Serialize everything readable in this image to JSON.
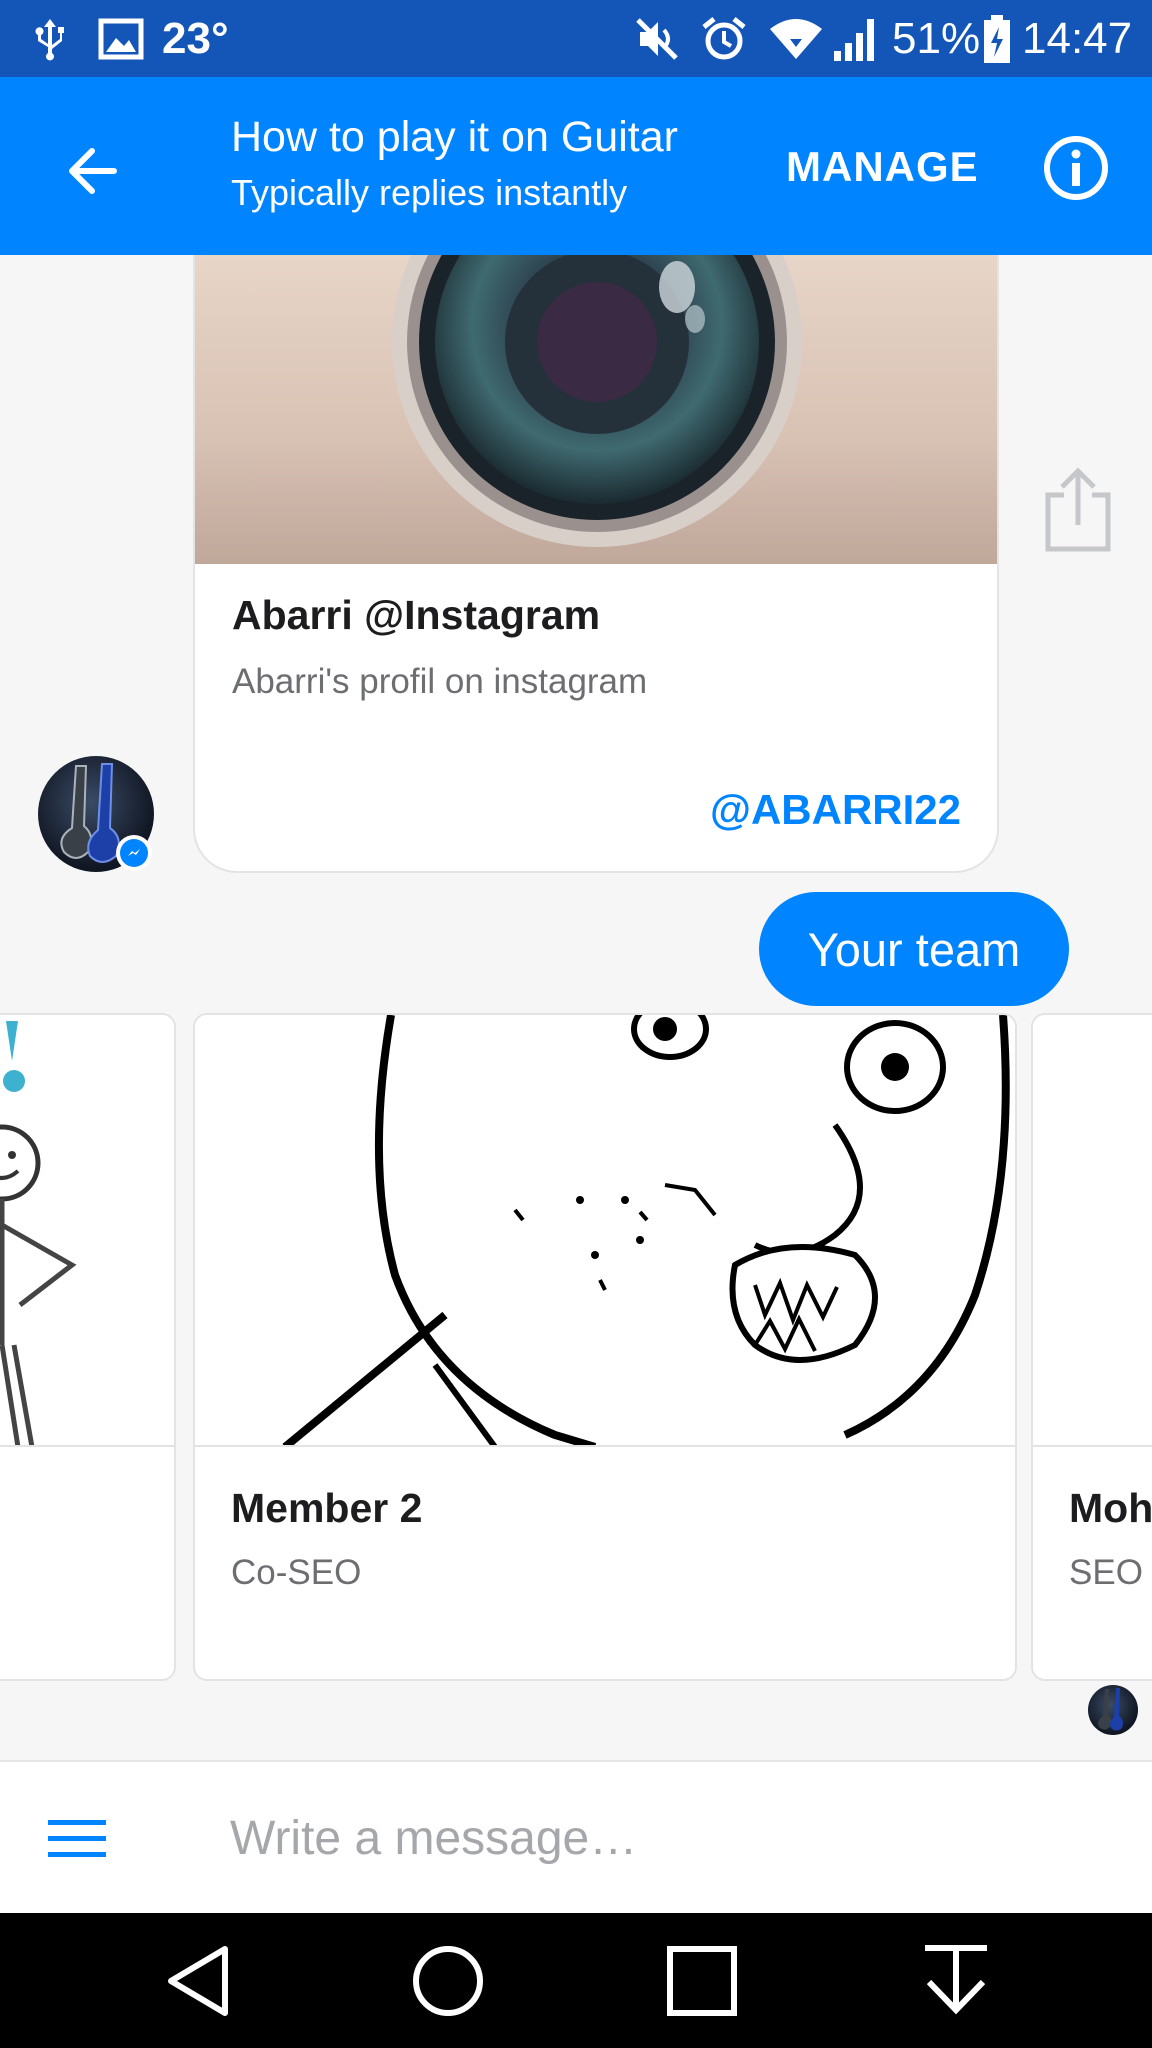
{
  "status_bar": {
    "temperature": "23°",
    "battery": "51%",
    "time": "14:47",
    "icons": [
      "usb-icon",
      "image-icon",
      "mute-icon",
      "alarm-icon",
      "wifi-icon",
      "signal-icon",
      "battery-icon"
    ]
  },
  "header": {
    "title": "How to play it on Guitar",
    "subtitle": "Typically replies instantly",
    "manage_label": "MANAGE"
  },
  "instagram_card": {
    "title": "Abarri @Instagram",
    "subtitle": "Abarri's profil on instagram",
    "link_label": "@ABARRI22"
  },
  "sent_message": "Your team",
  "team_cards": [
    {
      "title": "Member 2",
      "subtitle": "Co-SEO"
    },
    {
      "title": "Moh",
      "subtitle": "SEO"
    }
  ],
  "composer": {
    "placeholder": "Write a message…"
  },
  "colors": {
    "status_bar": "#1456b8",
    "app_bar": "#0084ff",
    "accent": "#0084ff",
    "background": "#f6f6f7"
  }
}
